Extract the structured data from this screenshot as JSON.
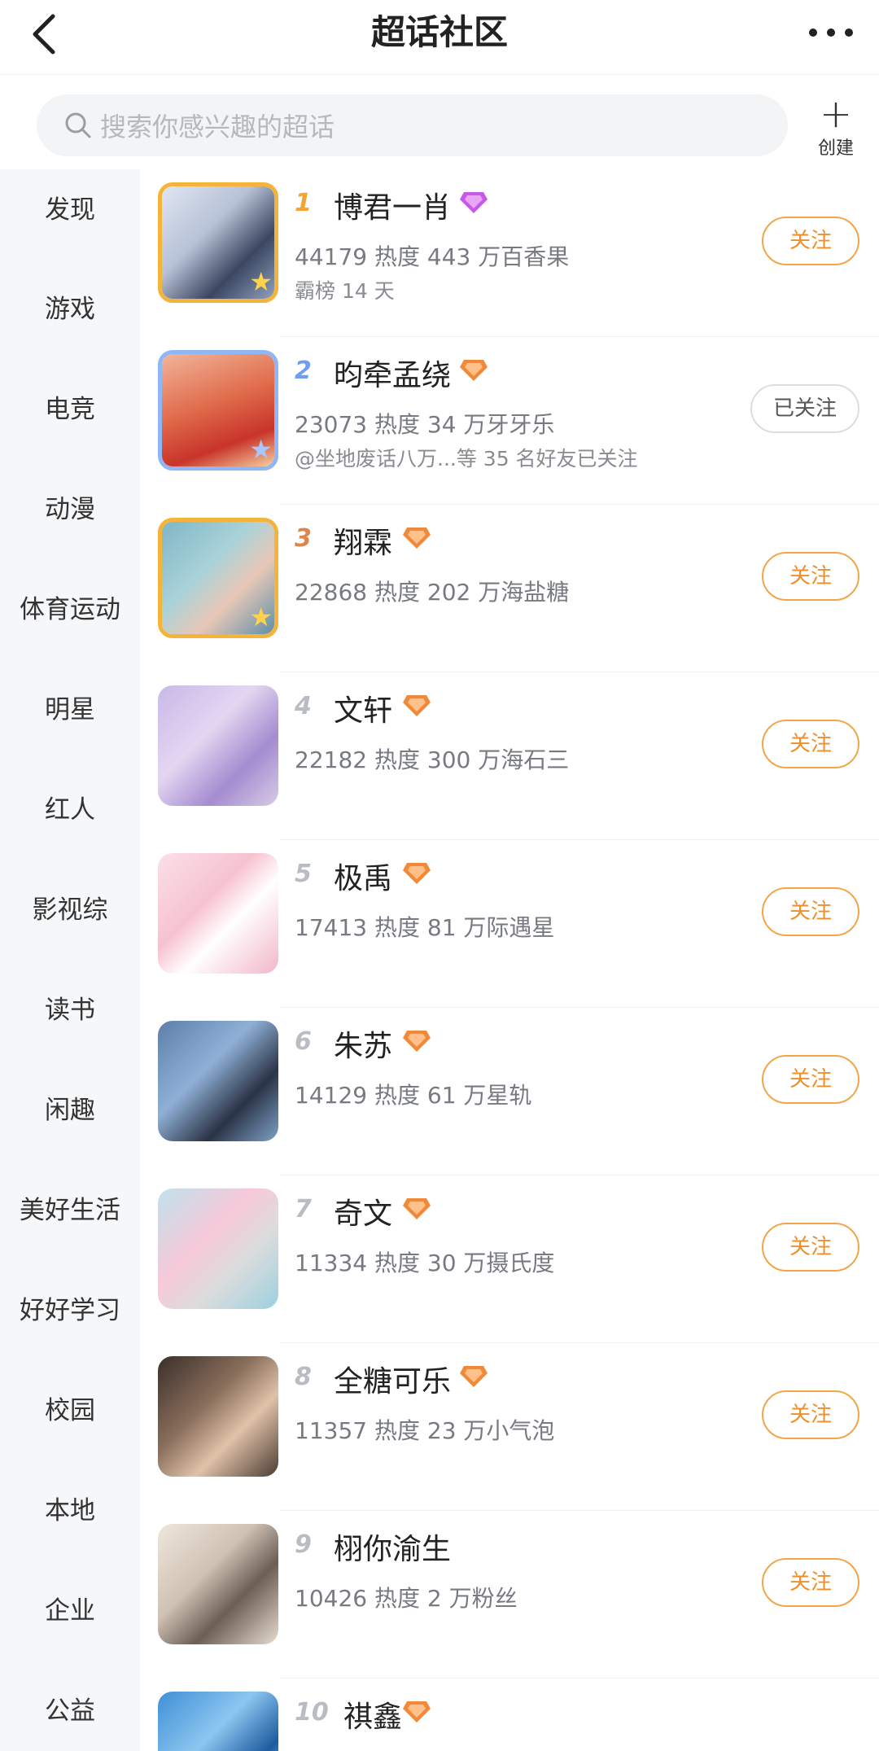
{
  "header": {
    "title": "超话社区"
  },
  "search": {
    "placeholder": "搜索你感兴趣的超话"
  },
  "create": {
    "label": "创建"
  },
  "sidebar": {
    "items": [
      "发现",
      "游戏",
      "电竞",
      "动漫",
      "体育运动",
      "明星",
      "红人",
      "影视综",
      "读书",
      "闲趣",
      "美好生活",
      "好好学习",
      "校园",
      "本地",
      "企业",
      "公益"
    ]
  },
  "colors": {
    "accent": "#f1a64a",
    "follow_text": "#ef8f2a",
    "gem_purple": "#c659e6",
    "gem_orange": "#f08a3a"
  },
  "topics": [
    {
      "rank": "1",
      "name": "博君一肖",
      "stats": "44179 热度 443 万百香果",
      "sub": "霸榜 14 天",
      "button": "关注",
      "followed": false,
      "gem": "purple-gem-icon"
    },
    {
      "rank": "2",
      "name": "昀牵孟绕",
      "stats": "23073 热度 34 万牙牙乐",
      "sub": "@坐地废话八万...等 35 名好友已关注",
      "button": "已关注",
      "followed": true,
      "gem": "orange-gem-icon"
    },
    {
      "rank": "3",
      "name": "翔霖",
      "stats": "22868 热度 202 万海盐糖",
      "sub": "",
      "button": "关注",
      "followed": false,
      "gem": "orange-gem-icon"
    },
    {
      "rank": "4",
      "name": "文轩",
      "stats": "22182 热度 300 万海石三",
      "sub": "",
      "button": "关注",
      "followed": false,
      "gem": "orange-gem-icon"
    },
    {
      "rank": "5",
      "name": "极禹",
      "stats": "17413 热度 81 万际遇星",
      "sub": "",
      "button": "关注",
      "followed": false,
      "gem": "orange-gem-icon"
    },
    {
      "rank": "6",
      "name": "朱苏",
      "stats": "14129 热度 61 万星轨",
      "sub": "",
      "button": "关注",
      "followed": false,
      "gem": "orange-gem-icon"
    },
    {
      "rank": "7",
      "name": "奇文",
      "stats": "11334 热度 30 万摄氏度",
      "sub": "",
      "button": "关注",
      "followed": false,
      "gem": "orange-gem-icon"
    },
    {
      "rank": "8",
      "name": "全糖可乐",
      "stats": "11357 热度 23 万小气泡",
      "sub": "",
      "button": "关注",
      "followed": false,
      "gem": "orange-gem-icon"
    },
    {
      "rank": "9",
      "name": "栩你渝生",
      "stats": "10426 热度 2 万粉丝",
      "sub": "",
      "button": "关注",
      "followed": false,
      "gem": ""
    },
    {
      "rank": "10",
      "name": "祺鑫",
      "stats": "",
      "sub": "",
      "button": "",
      "followed": false,
      "gem": "orange-gem-icon"
    }
  ]
}
